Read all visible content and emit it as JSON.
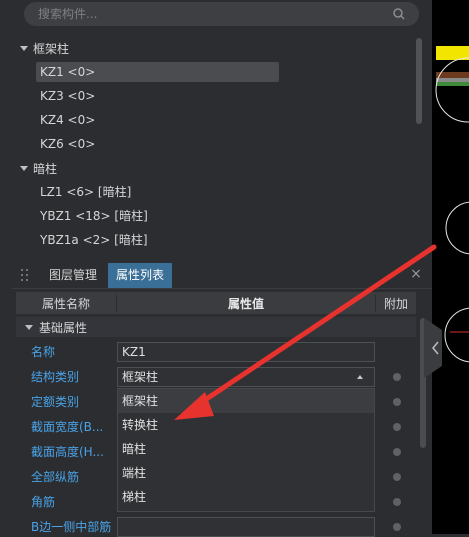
{
  "search": {
    "placeholder": "搜索构件..."
  },
  "tree": {
    "groups": [
      {
        "label": "框架柱",
        "items": [
          "KZ1 <0>",
          "KZ3 <0>",
          "KZ4 <0>",
          "KZ6 <0>"
        ]
      },
      {
        "label": "暗柱",
        "items": [
          "LZ1 <6> [暗柱]",
          "YBZ1 <18> [暗柱]",
          "YBZ1a <2> [暗柱]"
        ]
      }
    ],
    "selected": "KZ1 <0>"
  },
  "tabs": {
    "layers": "图层管理",
    "properties": "属性列表",
    "close": "×"
  },
  "table": {
    "headers": {
      "name": "属性名称",
      "value": "属性值",
      "extra": "附加"
    },
    "section": "基础属性",
    "rows": [
      {
        "label": "名称",
        "value": "KZ1"
      },
      {
        "label": "结构类别",
        "value": "框架柱"
      },
      {
        "label": "定额类别",
        "value": ""
      },
      {
        "label": "截面宽度(B...",
        "value": ""
      },
      {
        "label": "截面高度(H...",
        "value": ""
      },
      {
        "label": "全部纵筋",
        "value": ""
      },
      {
        "label": "角筋",
        "value": ""
      },
      {
        "label": "B边一侧中部筋",
        "value": ""
      }
    ]
  },
  "dropdown": {
    "options": [
      "框架柱",
      "转换柱",
      "暗柱",
      "端柱",
      "梯柱"
    ],
    "selected": "框架柱"
  },
  "colors": {
    "accent_tab": "#3a6f97",
    "label_blue": "#4aa3e8",
    "annotation_red": "#e8322e",
    "canvas_yellow": "#f2e600"
  },
  "icons": [
    "search-icon",
    "drag-grip-icon",
    "close-icon",
    "collapse-arrow-icon"
  ]
}
